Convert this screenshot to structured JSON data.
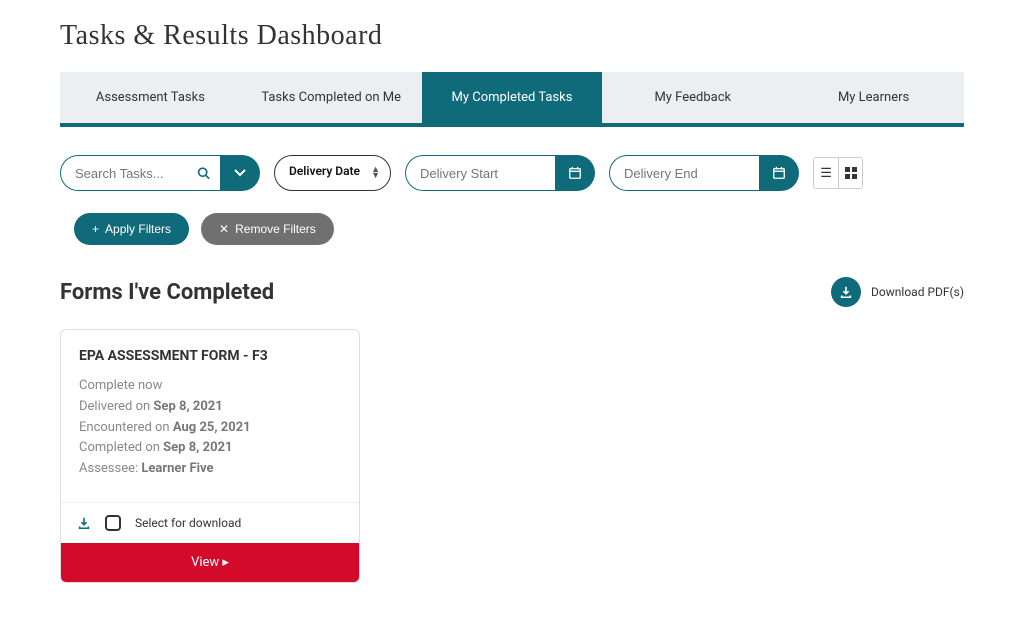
{
  "page": {
    "title": "Tasks & Results Dashboard"
  },
  "tabs": [
    {
      "label": "Assessment Tasks"
    },
    {
      "label": "Tasks Completed on Me"
    },
    {
      "label": "My Completed Tasks"
    },
    {
      "label": "My Feedback"
    },
    {
      "label": "My Learners"
    }
  ],
  "active_tab_index": 2,
  "filters": {
    "search_placeholder": "Search Tasks...",
    "delivery_select_label": "Delivery Date",
    "delivery_start_placeholder": "Delivery Start",
    "delivery_end_placeholder": "Delivery End"
  },
  "actions": {
    "apply_label": "Apply Filters",
    "remove_label": "Remove Filters"
  },
  "section": {
    "title": "Forms I've Completed",
    "download_label": "Download PDF(s)"
  },
  "card": {
    "title": "EPA ASSESSMENT FORM - F3",
    "status": "Complete now",
    "delivered_prefix": "Delivered on ",
    "delivered_date": "Sep 8, 2021",
    "encountered_prefix": "Encountered on ",
    "encountered_date": "Aug 25, 2021",
    "completed_prefix": "Completed on ",
    "completed_date": "Sep 8, 2021",
    "assessee_prefix": "Assessee: ",
    "assessee_name": "Learner Five",
    "select_label": "Select for download",
    "view_label": "View  ▸"
  },
  "colors": {
    "accent": "#0f6b7a",
    "danger": "#d40a2a",
    "muted": "#707070"
  }
}
